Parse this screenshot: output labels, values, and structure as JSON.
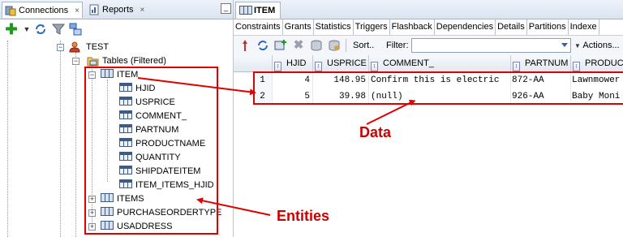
{
  "left_panel": {
    "tabs": [
      {
        "label": "Connections",
        "close": "×"
      },
      {
        "label": "Reports",
        "close": "×"
      }
    ],
    "minimize": "_",
    "tree": {
      "connection": "TEST",
      "tables_folder": "Tables (Filtered)",
      "expanded_table": "ITEM",
      "columns": [
        "HJID",
        "USPRICE",
        "COMMENT_",
        "PARTNUM",
        "PRODUCTNAME",
        "QUANTITY",
        "SHIPDATEITEM",
        "ITEM_ITEMS_HJID"
      ],
      "other_tables": [
        "ITEMS",
        "PURCHASEORDERTYPE",
        "USADDRESS"
      ]
    }
  },
  "right_panel": {
    "tab_title": "ITEM",
    "subtabs": [
      "Constraints",
      "Grants",
      "Statistics",
      "Triggers",
      "Flashback",
      "Dependencies",
      "Details",
      "Partitions",
      "Indexe"
    ],
    "toolbar": {
      "sort_label": "Sort..",
      "filter_label": "Filter:",
      "filter_value": "",
      "actions_label": "Actions..."
    },
    "grid": {
      "headers": [
        "HJID",
        "USPRICE",
        "COMMENT_",
        "PARTNUM",
        "PRODUC"
      ],
      "rows": [
        {
          "n": "1",
          "hjid": "4",
          "usprice": "148.95",
          "comment": "Confirm this is electric",
          "partnum": "872-AA",
          "product": "Lawnmower"
        },
        {
          "n": "2",
          "hjid": "5",
          "usprice": "39.98",
          "comment": "(null)",
          "partnum": "926-AA",
          "product": "Baby Moni"
        }
      ]
    }
  },
  "annotations": {
    "data_label": "Data",
    "entities_label": "Entities",
    "color": "#e00000"
  }
}
